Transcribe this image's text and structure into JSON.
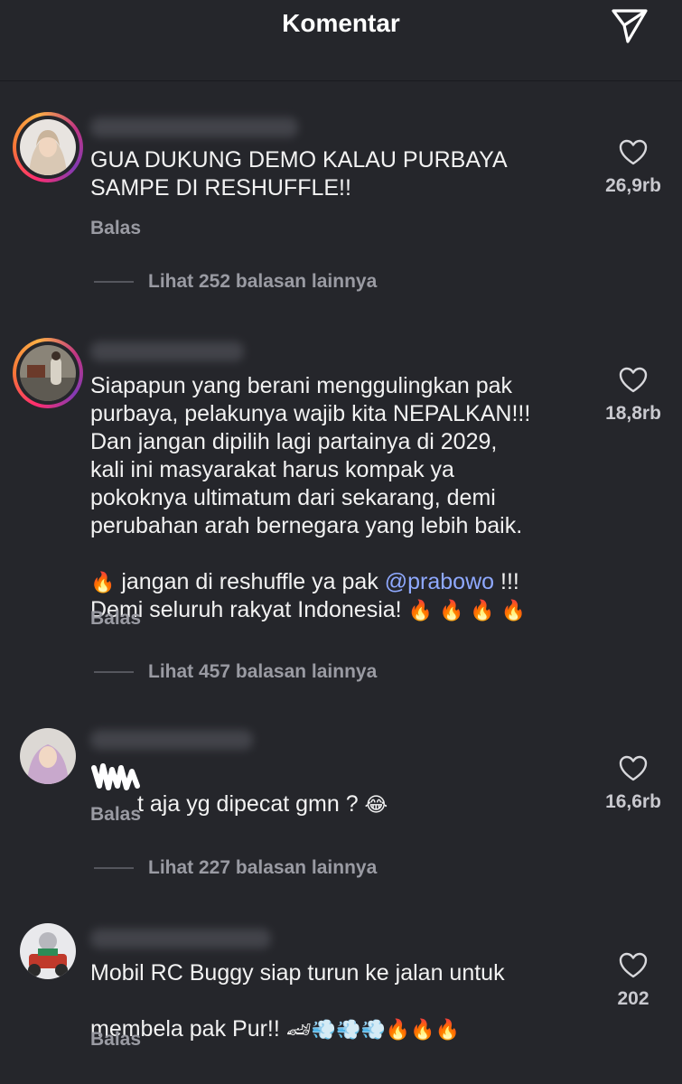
{
  "header": {
    "title": "Komentar"
  },
  "comments": [
    {
      "text": "GUA DUKUNG DEMO KALAU PURBAYA\nSAMPE DI RESHUFFLE!!",
      "likes": "26,9rb",
      "reply_label": "Balas",
      "more_replies": "Lihat 252 balasan lainnya"
    },
    {
      "text_main": "Siapapun yang berani menggulingkan pak\npurbaya, pelakunya wajib kita NEPALKAN!!!\nDan jangan dipilih lagi partainya di 2029,\nkali ini masyarakat harus kompak ya\npokoknya ultimatum dari sekarang, demi\nperubahan arah bernegara yang lebih baik.",
      "text_pre_mention": " jangan di reshuffle ya pak ",
      "mention": "@prabowo",
      "text_post_mention": " !!!",
      "text_last": "Demi seluruh rakyat Indonesia! ",
      "emoji_fire": "🔥",
      "emoji_fire_row": "🔥 🔥 🔥 🔥",
      "likes": "18,8rb",
      "reply_label": "Balas",
      "more_replies": "Lihat 457 balasan lainnya"
    },
    {
      "text": "t aja yg dipecat gmn ? ",
      "emoji": "😂",
      "likes": "16,6rb",
      "reply_label": "Balas",
      "more_replies": "Lihat 227 balasan lainnya"
    },
    {
      "text_line1": "Mobil RC Buggy siap turun ke jalan untuk",
      "text_line2": "membela pak Pur!! ",
      "emojis": "🏎💨💨💨🔥🔥🔥",
      "likes": "202",
      "reply_label": "Balas"
    }
  ]
}
